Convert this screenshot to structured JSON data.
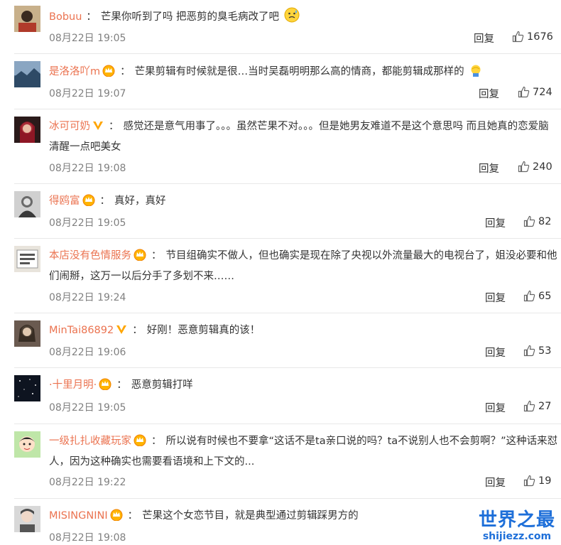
{
  "comments": [
    {
      "user": "Bobuu",
      "badge": "",
      "text": "芒果你听到了吗 把恶剪的臭毛病改了吧",
      "time": "08月22日 19:05",
      "reply_label": "回复",
      "likes": "1676",
      "emoji": "sweat"
    },
    {
      "user": "是洛洛吖m",
      "badge": "crown",
      "text": "芒果剪辑有时候就是很…当时吴磊明明那么高的情商，都能剪辑成那样的",
      "time": "08月22日 19:07",
      "reply_label": "回复",
      "likes": "724",
      "emoji": "facepalm"
    },
    {
      "user": "冰可可奶",
      "badge": "v",
      "text": "感觉还是意气用事了。。。虽然芒果不对。。。但是她男友难道不是这个意思吗 而且她真的恋爱脑 清醒一点吧美女",
      "time": "08月22日 19:08",
      "reply_label": "回复",
      "likes": "240",
      "emoji": ""
    },
    {
      "user": "得鸥富",
      "badge": "crown",
      "text": "真好，真好",
      "time": "08月22日 19:05",
      "reply_label": "回复",
      "likes": "82",
      "emoji": ""
    },
    {
      "user": "本店没有色情服务",
      "badge": "crown",
      "text": "节目组确实不做人，但也确实是现在除了央视以外流量最大的电视台了，姐没必要和他们闹掰，这万一以后分手了多划不来……",
      "time": "08月22日 19:24",
      "reply_label": "回复",
      "likes": "65",
      "emoji": ""
    },
    {
      "user": "MinTai86892",
      "badge": "v",
      "text": "好刚！恶意剪辑真的该！",
      "time": "08月22日 19:06",
      "reply_label": "回复",
      "likes": "53",
      "emoji": ""
    },
    {
      "user": "·十里月明·",
      "badge": "crown",
      "text": "恶意剪辑打咩",
      "time": "08月22日 19:05",
      "reply_label": "回复",
      "likes": "27",
      "emoji": ""
    },
    {
      "user": "一级扎扎收藏玩家",
      "badge": "crown",
      "text": "所以说有时候也不要拿“这话不是ta亲口说的吗？ta不说别人也不会剪啊？”这种话来怼人，因为这种确实也需要看语境和上下文的...",
      "time": "08月22日 19:22",
      "reply_label": "回复",
      "likes": "19",
      "emoji": ""
    },
    {
      "user": "MISINGNINI",
      "badge": "crown",
      "text": "芒果这个女恋节目，就是典型通过剪辑踩男方的",
      "time": "08月22日 19:08",
      "reply_label": "",
      "likes": "",
      "emoji": ""
    }
  ],
  "watermark": {
    "title": "世界之最",
    "url": "shijiezz.com"
  },
  "colors": {
    "username": "#eb7350",
    "text": "#333333",
    "time": "#808080",
    "watermark": "#1e6fd9"
  }
}
